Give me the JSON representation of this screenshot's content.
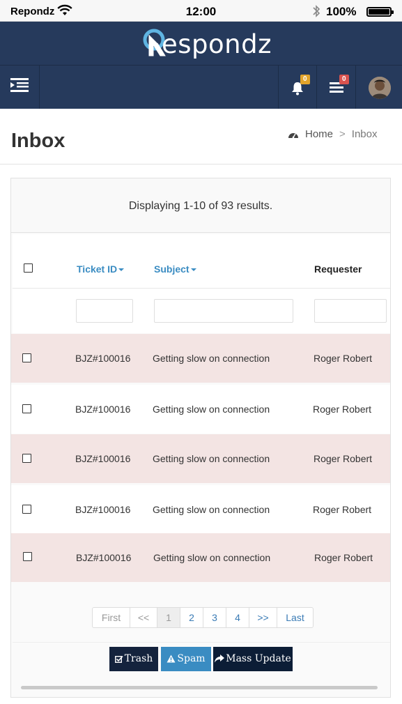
{
  "status_bar": {
    "carrier": "Repondz",
    "time": "12:00",
    "battery": "100%"
  },
  "brand": {
    "name": "espondz"
  },
  "nav": {
    "notifications_count": "0",
    "tasks_count": "0",
    "badge_colors": {
      "notifications": "#e2a42b",
      "tasks": "#d9534f"
    }
  },
  "page": {
    "title": "Inbox",
    "breadcrumb": {
      "home": "Home",
      "separator": ">",
      "current": "Inbox"
    }
  },
  "summary": "Displaying 1-10 of 93 results.",
  "table": {
    "columns": {
      "ticket_id": "Ticket ID",
      "subject": "Subject",
      "requester": "Requester"
    },
    "rows": [
      {
        "ticket_id": "BJZ#100016",
        "subject": "Getting slow on connection",
        "requester": "Roger Robert"
      },
      {
        "ticket_id": "BJZ#100016",
        "subject": "Getting slow on connection",
        "requester": "Roger Robert"
      },
      {
        "ticket_id": "BJZ#100016",
        "subject": "Getting slow on connection",
        "requester": "Roger Robert"
      },
      {
        "ticket_id": "BJZ#100016",
        "subject": "Getting slow on connection",
        "requester": "Roger Robert"
      },
      {
        "ticket_id": "BJZ#100016",
        "subject": "Getting slow on connection",
        "requester": "Roger Robert"
      }
    ]
  },
  "pagination": {
    "first": "First",
    "prev": "<<",
    "pages": [
      "1",
      "2",
      "3",
      "4"
    ],
    "next": ">>",
    "last": "Last",
    "current": "1"
  },
  "actions": {
    "trash": "Trash",
    "spam": "Spam",
    "mass_update": "Mass Update"
  },
  "colors": {
    "header_bg": "#263a5c",
    "accent": "#3a8cc2",
    "row_highlight": "#f3e4e3"
  }
}
